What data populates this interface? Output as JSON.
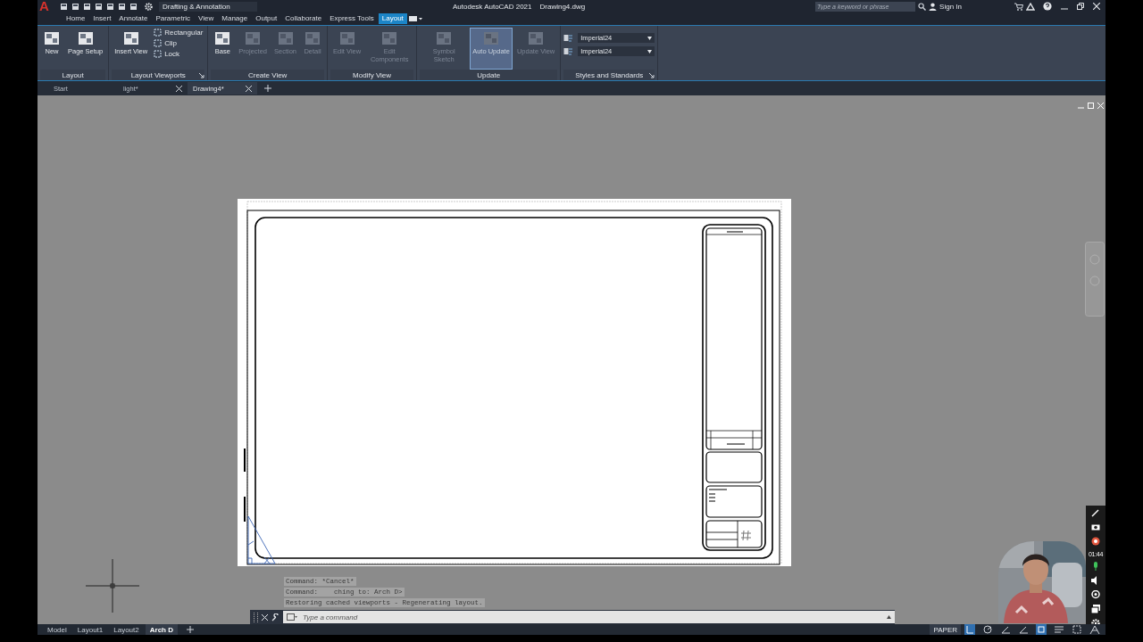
{
  "app": {
    "logo": "A",
    "workspace": "Drafting & Annotation",
    "title": "Autodesk AutoCAD 2021",
    "filename": "Drawing4.dwg",
    "search_placeholder": "Type a keyword or phrase",
    "sign_in": "Sign In"
  },
  "ribbon_tabs": [
    {
      "label": "Home",
      "selected": false
    },
    {
      "label": "Insert",
      "selected": false
    },
    {
      "label": "Annotate",
      "selected": false
    },
    {
      "label": "Parametric",
      "selected": false
    },
    {
      "label": "View",
      "selected": false
    },
    {
      "label": "Manage",
      "selected": false
    },
    {
      "label": "Output",
      "selected": false
    },
    {
      "label": "Collaborate",
      "selected": false
    },
    {
      "label": "Express Tools",
      "selected": false
    },
    {
      "label": "Layout",
      "selected": true
    }
  ],
  "ribbon_panels": [
    {
      "title": "Layout",
      "launcher": false,
      "tools": [
        {
          "kind": "large",
          "label": "New",
          "disabled": false,
          "selected": false
        },
        {
          "kind": "large",
          "label": "Page Setup",
          "disabled": false,
          "selected": false
        }
      ]
    },
    {
      "title": "Layout Viewports",
      "launcher": true,
      "tools": [
        {
          "kind": "large",
          "label": "Insert View",
          "disabled": false,
          "selected": false
        },
        {
          "kind": "small",
          "label": "Rectangular",
          "disabled": false
        },
        {
          "kind": "small",
          "label": "Clip",
          "disabled": false
        },
        {
          "kind": "small",
          "label": "Lock",
          "disabled": false
        }
      ]
    },
    {
      "title": "Create View",
      "launcher": false,
      "tools": [
        {
          "kind": "large",
          "label": "Base",
          "disabled": false,
          "selected": false
        },
        {
          "kind": "large",
          "label": "Projected",
          "disabled": true,
          "selected": false
        },
        {
          "kind": "large",
          "label": "Section",
          "disabled": true,
          "selected": false
        },
        {
          "kind": "large",
          "label": "Detail",
          "disabled": true,
          "selected": false
        }
      ]
    },
    {
      "title": "Modify View",
      "launcher": false,
      "tools": [
        {
          "kind": "large",
          "label": "Edit View",
          "disabled": true,
          "selected": false
        },
        {
          "kind": "large",
          "label": "Edit Components",
          "disabled": true,
          "selected": false
        }
      ]
    },
    {
      "title": "Update",
      "launcher": false,
      "tools": [
        {
          "kind": "large",
          "label": "Symbol Sketch",
          "disabled": true,
          "selected": false
        },
        {
          "kind": "large",
          "label": "Auto Update",
          "disabled": true,
          "selected": true
        },
        {
          "kind": "large",
          "label": "Update View",
          "disabled": true,
          "selected": false
        }
      ]
    },
    {
      "title": "Styles and Standards",
      "launcher": true,
      "tools": [
        {
          "kind": "dropdown",
          "label": "Imperial24",
          "disabled": false
        },
        {
          "kind": "dropdown",
          "label": "Imperial24",
          "disabled": false
        }
      ]
    }
  ],
  "file_tabs": [
    {
      "label": "Start",
      "selected": false,
      "closable": false
    },
    {
      "label": "light*",
      "selected": false,
      "closable": true
    },
    {
      "label": "Drawing4*",
      "selected": true,
      "closable": true
    }
  ],
  "command_history": [
    "Command: *Cancel*",
    "Command:    ching to: Arch D>",
    "Restoring cached viewports - Regenerating layout."
  ],
  "command_placeholder": "Type a command",
  "layout_tabs": [
    {
      "label": "Model",
      "selected": false
    },
    {
      "label": "Layout1",
      "selected": false
    },
    {
      "label": "Layout2",
      "selected": false
    },
    {
      "label": "Arch D",
      "selected": true
    }
  ],
  "status_bar": {
    "space": "PAPER"
  },
  "recorder": {
    "timer": "01:44"
  },
  "webcam": {
    "kind": "picture"
  }
}
